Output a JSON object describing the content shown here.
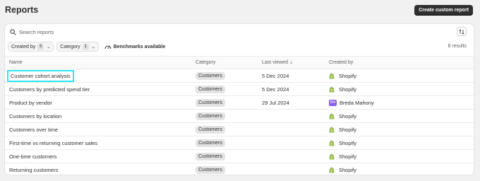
{
  "page": {
    "title": "Reports",
    "create_button": "Create custom report"
  },
  "search": {
    "placeholder": "Search reports"
  },
  "filters": [
    {
      "label": "Created by",
      "count": "5"
    },
    {
      "label": "Category",
      "count": "1"
    }
  ],
  "benchmarks_label": "Benchmarks available",
  "results_count": "8 results",
  "table": {
    "columns": [
      "Name",
      "Category",
      "Last viewed",
      "Created by"
    ],
    "rows": [
      {
        "name": "Customer cohort analysis",
        "category": "Customers",
        "last_viewed": "5 Dec 2024",
        "created_by": "Shopify",
        "creator_type": "shopify"
      },
      {
        "name": "Customers by predicted spend tier",
        "category": "Customers",
        "last_viewed": "5 Dec 2024",
        "created_by": "Shopify",
        "creator_type": "shopify"
      },
      {
        "name": "Product by vendor",
        "category": "Customers",
        "last_viewed": "29 Jul 2024",
        "created_by": "Breda Mahony",
        "creator_type": "user",
        "initials": "BM"
      },
      {
        "name": "Customers by location",
        "category": "Customers",
        "last_viewed": "",
        "created_by": "Shopify",
        "creator_type": "shopify"
      },
      {
        "name": "Customers over time",
        "category": "Customers",
        "last_viewed": "",
        "created_by": "Shopify",
        "creator_type": "shopify"
      },
      {
        "name": "First-time vs returning customer sales",
        "category": "Customers",
        "last_viewed": "",
        "created_by": "Shopify",
        "creator_type": "shopify"
      },
      {
        "name": "One-time customers",
        "category": "Customers",
        "last_viewed": "",
        "created_by": "Shopify",
        "creator_type": "shopify"
      },
      {
        "name": "Returning customers",
        "category": "Customers",
        "last_viewed": "",
        "created_by": "Shopify",
        "creator_type": "shopify"
      }
    ]
  },
  "colors": {
    "primary_button": "#303030",
    "highlight": "#2ee4f3",
    "shopify_green": "#95bf47",
    "avatar_purple": "#8a5cf0"
  }
}
